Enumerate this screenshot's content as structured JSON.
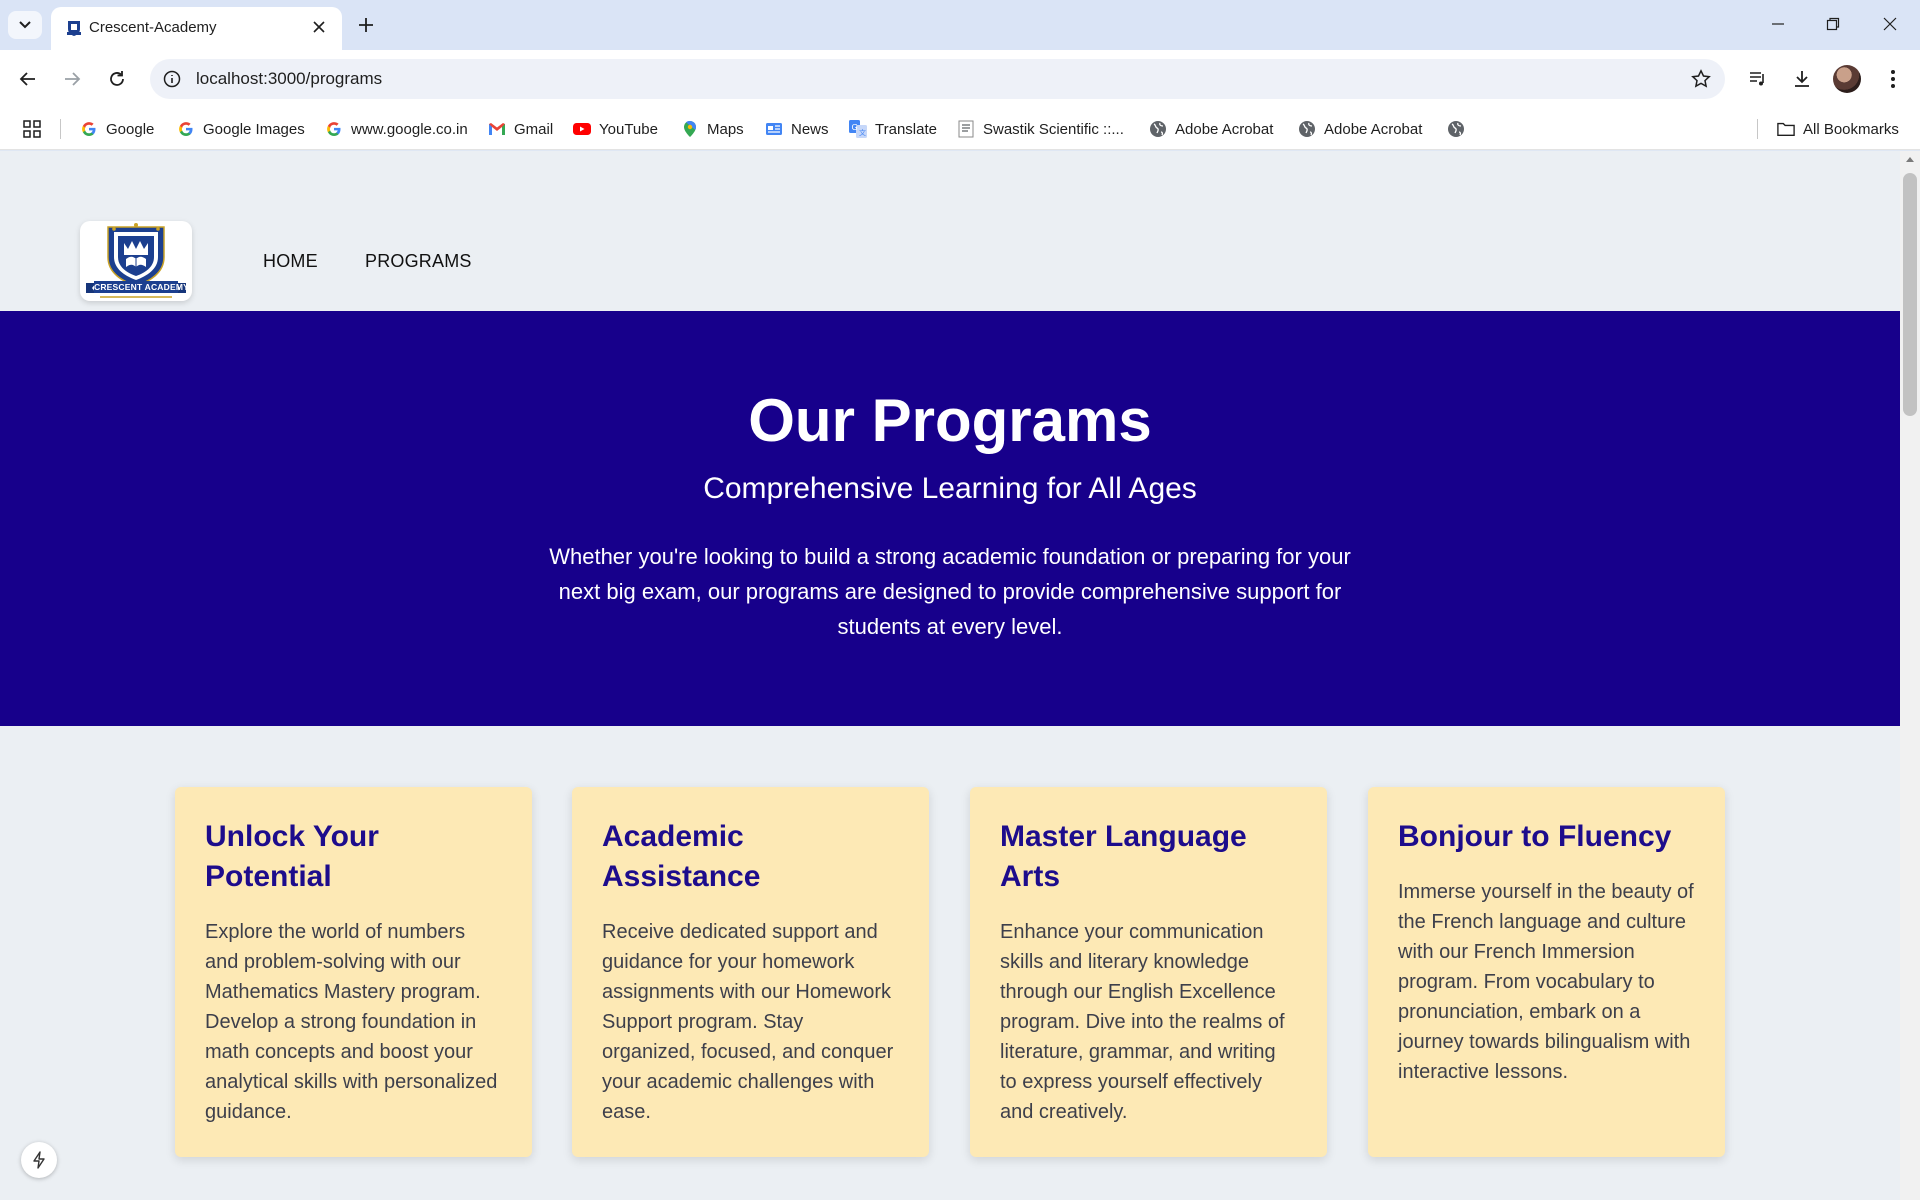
{
  "browser": {
    "tab": {
      "title": "Crescent-Academy"
    },
    "address": {
      "url": "localhost:3000/programs"
    },
    "bookmarks": [
      {
        "label": "Google",
        "icon": "google-icon"
      },
      {
        "label": "Google Images",
        "icon": "google-icon"
      },
      {
        "label": "www.google.co.in",
        "icon": "google-icon"
      },
      {
        "label": "Gmail",
        "icon": "gmail-icon"
      },
      {
        "label": "YouTube",
        "icon": "youtube-icon"
      },
      {
        "label": "Maps",
        "icon": "maps-icon"
      },
      {
        "label": "News",
        "icon": "news-icon"
      },
      {
        "label": "Translate",
        "icon": "translate-icon"
      },
      {
        "label": "Swastik Scientific ::...",
        "icon": "document-icon"
      },
      {
        "label": "Adobe Acrobat",
        "icon": "globe-icon"
      },
      {
        "label": "Adobe Acrobat",
        "icon": "globe-icon"
      }
    ],
    "all_bookmarks": "All Bookmarks"
  },
  "site": {
    "logo_text": "CRESCENT ACADEMY",
    "nav": [
      {
        "label": "HOME"
      },
      {
        "label": "PROGRAMS"
      }
    ],
    "hero": {
      "title": "Our Programs",
      "subtitle": "Comprehensive Learning for All Ages",
      "description": "Whether you're looking to build a strong academic foundation or preparing for your next big exam, our programs are designed to provide comprehensive support for students at every level."
    },
    "cards": [
      {
        "title": "Unlock Your Potential",
        "body": "Explore the world of numbers and problem-solving with our Mathematics Mastery program. Develop a strong foundation in math concepts and boost your analytical skills with personalized guidance."
      },
      {
        "title": "Academic Assistance",
        "body": "Receive dedicated support and guidance for your homework assignments with our Homework Support program. Stay organized, focused, and conquer your academic challenges with ease."
      },
      {
        "title": "Master Language Arts",
        "body": "Enhance your communication skills and literary knowledge through our English Excellence program. Dive into the realms of literature, grammar, and writing to express yourself effectively and creatively."
      },
      {
        "title": "Bonjour to Fluency",
        "body": "Immerse yourself in the beauty of the French language and culture with our French Immersion program. From vocabulary to pronunciation, embark on a journey towards bilingualism with interactive lessons."
      }
    ]
  },
  "colors": {
    "hero_bg": "#17008b",
    "card_bg": "#fde9b5",
    "card_title": "#1d0c8c",
    "page_bg": "#ebeff3"
  }
}
